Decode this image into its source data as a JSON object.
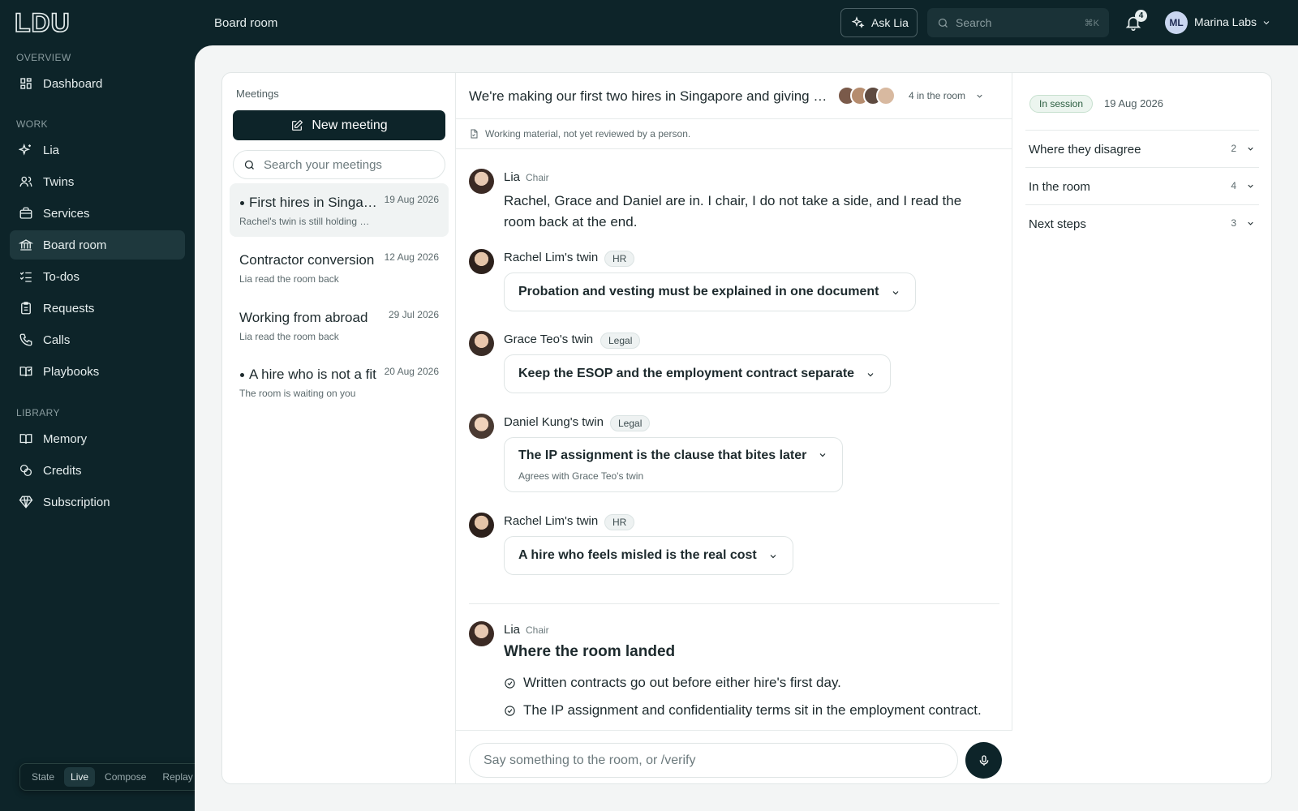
{
  "app": {
    "logo": "LDU",
    "page_title": "Board room"
  },
  "topbar": {
    "ask_label": "Ask Lia",
    "search_placeholder": "Search",
    "search_shortcut": "⌘K",
    "notification_count": "4",
    "user_initials": "ML",
    "org_name": "Marina Labs"
  },
  "sidebar": {
    "sections": [
      {
        "label": "OVERVIEW",
        "items": [
          {
            "label": "Dashboard",
            "icon": "dashboard-icon"
          }
        ]
      },
      {
        "label": "WORK",
        "items": [
          {
            "label": "Lia",
            "icon": "sparkle-icon"
          },
          {
            "label": "Twins",
            "icon": "users-icon"
          },
          {
            "label": "Services",
            "icon": "briefcase-icon"
          },
          {
            "label": "Board room",
            "icon": "bank-icon",
            "active": true
          },
          {
            "label": "To-dos",
            "icon": "checklist-icon"
          },
          {
            "label": "Requests",
            "icon": "clipboard-icon"
          },
          {
            "label": "Calls",
            "icon": "phone-icon"
          },
          {
            "label": "Playbooks",
            "icon": "book-open-icon"
          }
        ]
      },
      {
        "label": "LIBRARY",
        "items": [
          {
            "label": "Memory",
            "icon": "book-icon"
          },
          {
            "label": "Credits",
            "icon": "coins-icon"
          },
          {
            "label": "Subscription",
            "icon": "gem-icon"
          }
        ]
      }
    ]
  },
  "mode_switch": {
    "options": [
      "State",
      "Live",
      "Compose",
      "Replay"
    ],
    "selected": "Live"
  },
  "meetings": {
    "heading": "Meetings",
    "new_label": "New meeting",
    "search_placeholder": "Search your meetings",
    "items": [
      {
        "title": "First hires in Singapore",
        "date": "19 Aug 2026",
        "subtitle": "Rachel's twin is still holding out",
        "unread": true,
        "active": true
      },
      {
        "title": "Contractor conversion",
        "date": "12 Aug 2026",
        "subtitle": "Lia read the room back",
        "unread": false
      },
      {
        "title": "Working from abroad",
        "date": "29 Jul 2026",
        "subtitle": "Lia read the room back",
        "unread": false
      },
      {
        "title": "A hire who is not a fit",
        "date": "20 Aug 2026",
        "subtitle": "The room is waiting on you",
        "unread": true
      }
    ]
  },
  "conversation": {
    "title": "We're making our first two hires in Singapore and giving them equity",
    "room_count": "4 in the room",
    "notice": "Working material, not yet reviewed by a person.",
    "messages": [
      {
        "author": "Lia",
        "role": "Chair",
        "text": "Rachel, Grace and Daniel are in. I chair, I do not take a side, and I read the room back at the end."
      },
      {
        "author": "Rachel Lim's twin",
        "tag": "HR",
        "position": "Probation and vesting must be explained in one document"
      },
      {
        "author": "Grace Teo's twin",
        "tag": "Legal",
        "position": "Keep the ESOP and the employment contract separate"
      },
      {
        "author": "Daniel Kung's twin",
        "tag": "Legal",
        "position": "The IP assignment is the clause that bites later",
        "note": "Agrees with Grace Teo's twin"
      },
      {
        "author": "Rachel Lim's twin",
        "tag": "HR",
        "position": "A hire who feels misled is the real cost"
      }
    ],
    "summary": {
      "author": "Lia",
      "role": "Chair",
      "heading": "Where the room landed",
      "points": [
        "Written contracts go out before either hire's first day.",
        "The IP assignment and confidentiality terms sit in the employment contract."
      ]
    },
    "composer_placeholder": "Say something to the room, or /verify"
  },
  "details": {
    "status": "In session",
    "date": "19 Aug 2026",
    "sections": [
      {
        "label": "Where they disagree",
        "count": "2"
      },
      {
        "label": "In the room",
        "count": "4"
      },
      {
        "label": "Next steps",
        "count": "3"
      }
    ]
  },
  "colors": {
    "brand_dark": "#0d2429",
    "session_green": "#2a5c3f"
  }
}
